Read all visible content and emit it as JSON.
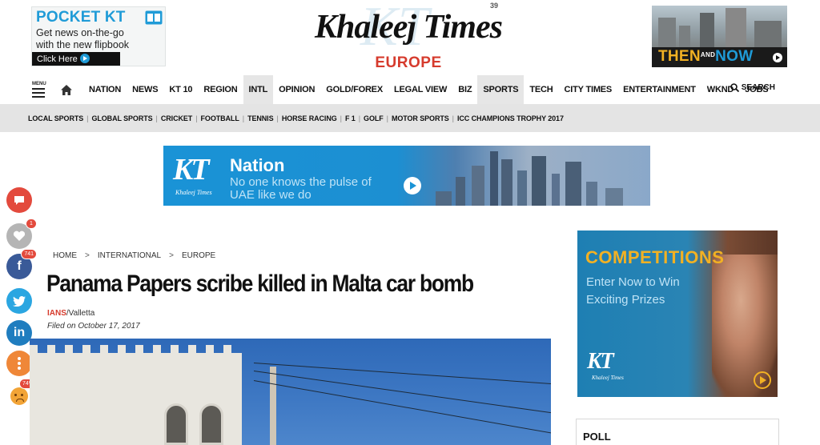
{
  "masthead": {
    "pocket_ad": {
      "title": "POCKET KT",
      "line1": "Get news on-the-go",
      "line2": "with the new flipbook",
      "cta": "Click Here"
    },
    "logo": {
      "name": "Khaleej Times",
      "edition": "EUROPE",
      "anniversary": "39"
    },
    "then_now_ad": {
      "then": "THEN",
      "and": "AND",
      "now": "NOW"
    }
  },
  "main_nav": {
    "menu_label": "MENU",
    "items": [
      {
        "label": "NATION",
        "active": false
      },
      {
        "label": "NEWS",
        "active": false
      },
      {
        "label": "KT 10",
        "active": false
      },
      {
        "label": "REGION",
        "active": false
      },
      {
        "label": "INTL",
        "active": true
      },
      {
        "label": "OPINION",
        "active": false
      },
      {
        "label": "GOLD/FOREX",
        "active": false
      },
      {
        "label": "LEGAL VIEW",
        "active": false
      },
      {
        "label": "BIZ",
        "active": false
      },
      {
        "label": "SPORTS",
        "active": true
      },
      {
        "label": "TECH",
        "active": false
      },
      {
        "label": "CITY TIMES",
        "active": false
      },
      {
        "label": "ENTERTAINMENT",
        "active": false
      },
      {
        "label": "WKND",
        "active": false
      },
      {
        "label": "JOBS",
        "active": false
      }
    ],
    "search_label": "SEARCH"
  },
  "sub_nav": {
    "items": [
      "LOCAL SPORTS",
      "GLOBAL SPORTS",
      "CRICKET",
      "FOOTBALL",
      "TENNIS",
      "HORSE RACING",
      "F 1",
      "GOLF",
      "MOTOR SPORTS",
      "ICC CHAMPIONS TROPHY 2017"
    ]
  },
  "nation_ad": {
    "logo": "KT",
    "logo_sub": "Khaleej Times",
    "title": "Nation",
    "line1": "No one knows the pulse of",
    "line2": "UAE like we do"
  },
  "social": {
    "comment_icon": "comment-icon",
    "heart_count": "1",
    "facebook_count": "741",
    "facebook_glyph": "f",
    "linkedin_glyph": "in",
    "reaction_percent": "74%"
  },
  "article": {
    "breadcrumb": [
      "HOME",
      "INTERNATIONAL",
      "EUROPE"
    ],
    "breadcrumb_sep": ">",
    "headline": "Panama Papers scribe killed in Malta car bomb",
    "source": "IANS",
    "location": "/Valletta",
    "filed": "Filed on October 17, 2017"
  },
  "competitions_ad": {
    "title": "COMPETITIONS",
    "line1": "Enter Now to Win",
    "line2": "Exciting Prizes",
    "logo": "KT",
    "logo_sub": "Khaleej Times"
  },
  "poll": {
    "title": "POLL"
  },
  "colors": {
    "brand_red": "#d63b2d",
    "brand_blue": "#1f9bd7",
    "accent_gold": "#f2b123",
    "nav_active_bg": "#e6e6e6",
    "subnav_bg": "#e4e4e4"
  }
}
